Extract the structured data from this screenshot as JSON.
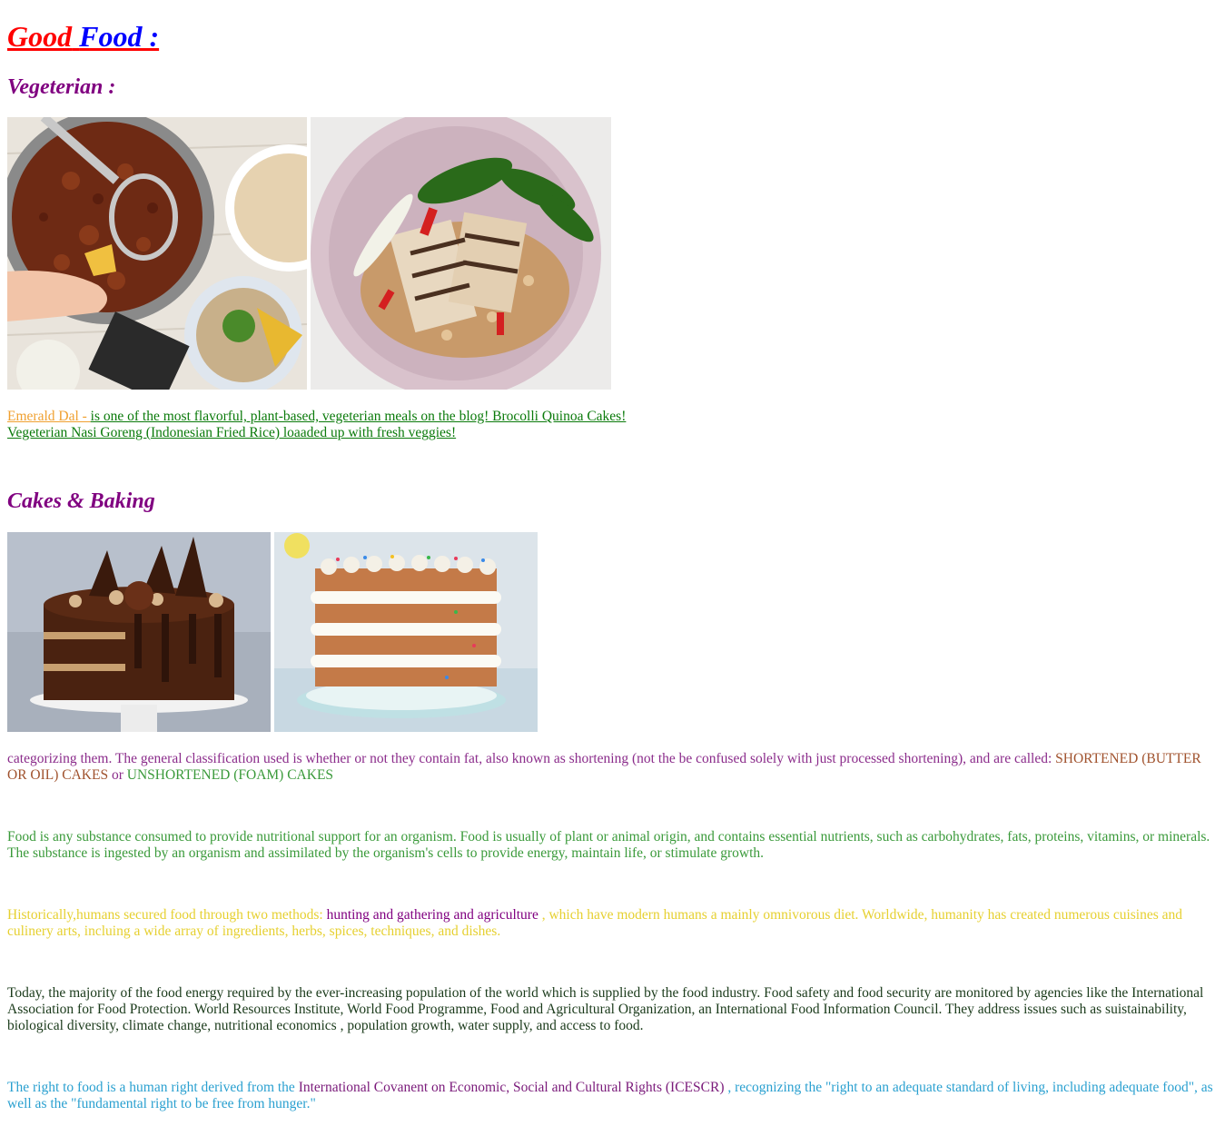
{
  "header": {
    "title_word1": "Good",
    "title_word2": "Food :"
  },
  "vegetarian": {
    "heading": "Vegeterian :",
    "images": [
      "chili-pot-photo",
      "tofu-rice-bowl-photo"
    ],
    "link1": "Emerald Dal - ",
    "text1": "is one of the most flavorful, plant-based, vegeterian meals on the blog! Brocolli Quinoa Cakes!",
    "text2": "Vegeterian Nasi Goreng (Indonesian Fried Rice) loaaded up with fresh veggies!"
  },
  "cakes": {
    "heading": "Cakes & Baking",
    "images": [
      "chocolate-cake-photo",
      "sprinkle-layer-cake-photo"
    ],
    "text_main": "categorizing them. The general classification used is whether or not they contain fat, also known as shortening (not the be confused solely with just processed shortening), and are called: ",
    "text_shortened": "SHORTENED (BUTTER OR OIL) CAKES",
    "text_or": " or ",
    "text_unshortened": "UNSHORTENED (FOAM) CAKES"
  },
  "paragraphs": {
    "p1": "Food is any substance consumed to provide nutritional support for an organism. Food is usually of plant or animal origin, and contains essential nutrients, such as carbohydrates, fats, proteins, vitamins, or minerals. The substance is ingested by an organism and assimilated by the organism's cells to provide energy, maintain life, or stimulate growth.",
    "p2_a": "Historically,humans secured food through two methods: ",
    "p2_b": "hunting and gathering and agriculture",
    "p2_c": " , which have modern humans a mainly omnivorous diet. Worldwide, humanity has created numerous cuisines and culinery arts, incluing a wide array of ingredients, herbs, spices, techniques, and dishes.",
    "p3": "Today, the majority of the food energy required by the ever-increasing population of the world which is supplied by the food industry. Food safety and food security are monitored by agencies like the International Association for Food Protection. World Resources Institute, World Food Programme, Food and Agricultural Organization, an International Food Information Council. They address issues such as suistainability, biological diversity, climate change, nutritional economics , population growth, water supply, and access to food.",
    "p4_a": "The right to food is a human right derived from the ",
    "p4_b": "International Covanent on Economic, Social and Cultural Rights (ICESCR)",
    "p4_c": " , recognizing the \"right to an adequate standard of living, including adequate food\", as well as the \"fundamental right to be free from hunger.\""
  },
  "colors": {
    "title_red": "#ff0000",
    "title_blue": "#0000ff",
    "heading_purple": "#800080",
    "link_green": "#0a7a0a",
    "orange": "#f0a030"
  }
}
